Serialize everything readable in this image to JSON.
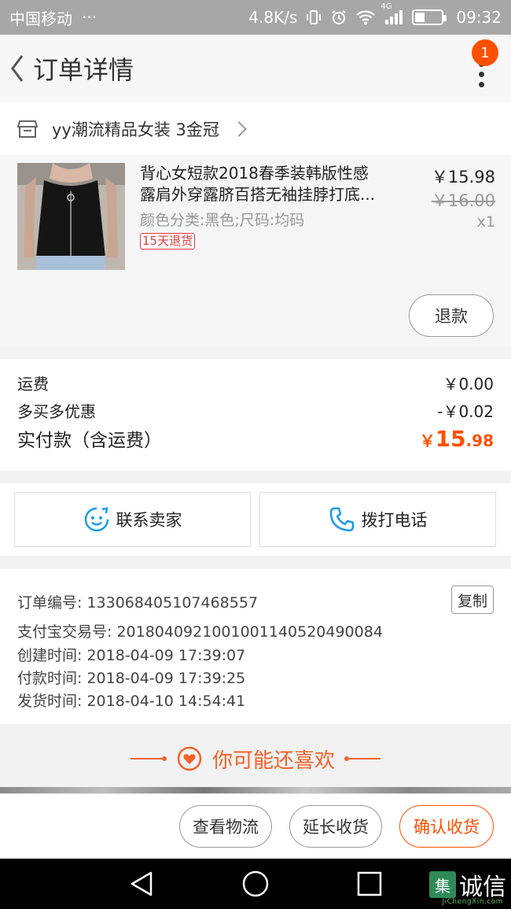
{
  "status_bar": {
    "carrier": "中国移动",
    "dots": "···",
    "speed": "4.8K/s",
    "network": "4G",
    "time": "09:32"
  },
  "header": {
    "title": "订单详情",
    "badge": "1"
  },
  "shop": {
    "name": "yy潮流精品女装 3金冠"
  },
  "item": {
    "title_line1": "背心女短款2018春季装韩版性感",
    "title_line2": "露肩外穿露脐百搭无袖挂脖打底...",
    "sku": "颜色分类:黑色;尺码:均码",
    "tag": "15天退货",
    "price": "￥15.98",
    "original_price": "￥16.00",
    "quantity": "x1",
    "refund_label": "退款"
  },
  "fees": {
    "shipping_label": "运费",
    "shipping_value": "￥0.00",
    "discount_label": "多买多优惠",
    "discount_value": "-￥0.02",
    "total_label": "实付款（含运费）",
    "total_currency": "￥",
    "total_integer": "15",
    "total_decimal": ".98"
  },
  "contact": {
    "seller_label": "联系卖家",
    "call_label": "拨打电话"
  },
  "order_info": {
    "order_no": "订单编号: 133068405107468557",
    "copy_label": "复制",
    "alipay_no": "支付宝交易号: 2018040921001001140520490084",
    "created": "创建时间: 2018-04-09 17:39:07",
    "paid": "付款时间: 2018-04-09 17:39:25",
    "shipped": "发货时间: 2018-04-10 14:54:41"
  },
  "recommend": {
    "title": "你可能还喜欢"
  },
  "actions": {
    "logistics": "查看物流",
    "extend": "延长收货",
    "confirm": "确认收货"
  },
  "watermark": {
    "box": "集",
    "text": "诚信",
    "sub": "JiChengXin.com"
  },
  "colors": {
    "accent": "#ff5000",
    "recommend": "#f5612b",
    "tag_red": "#e4393c",
    "icon_blue": "#1e9be8"
  },
  "icons": {
    "back": "chevron-left-icon",
    "more": "more-vertical-icon",
    "shop": "store-icon",
    "seller": "chat-face-icon",
    "phone": "phone-icon",
    "heart": "heart-icon"
  }
}
